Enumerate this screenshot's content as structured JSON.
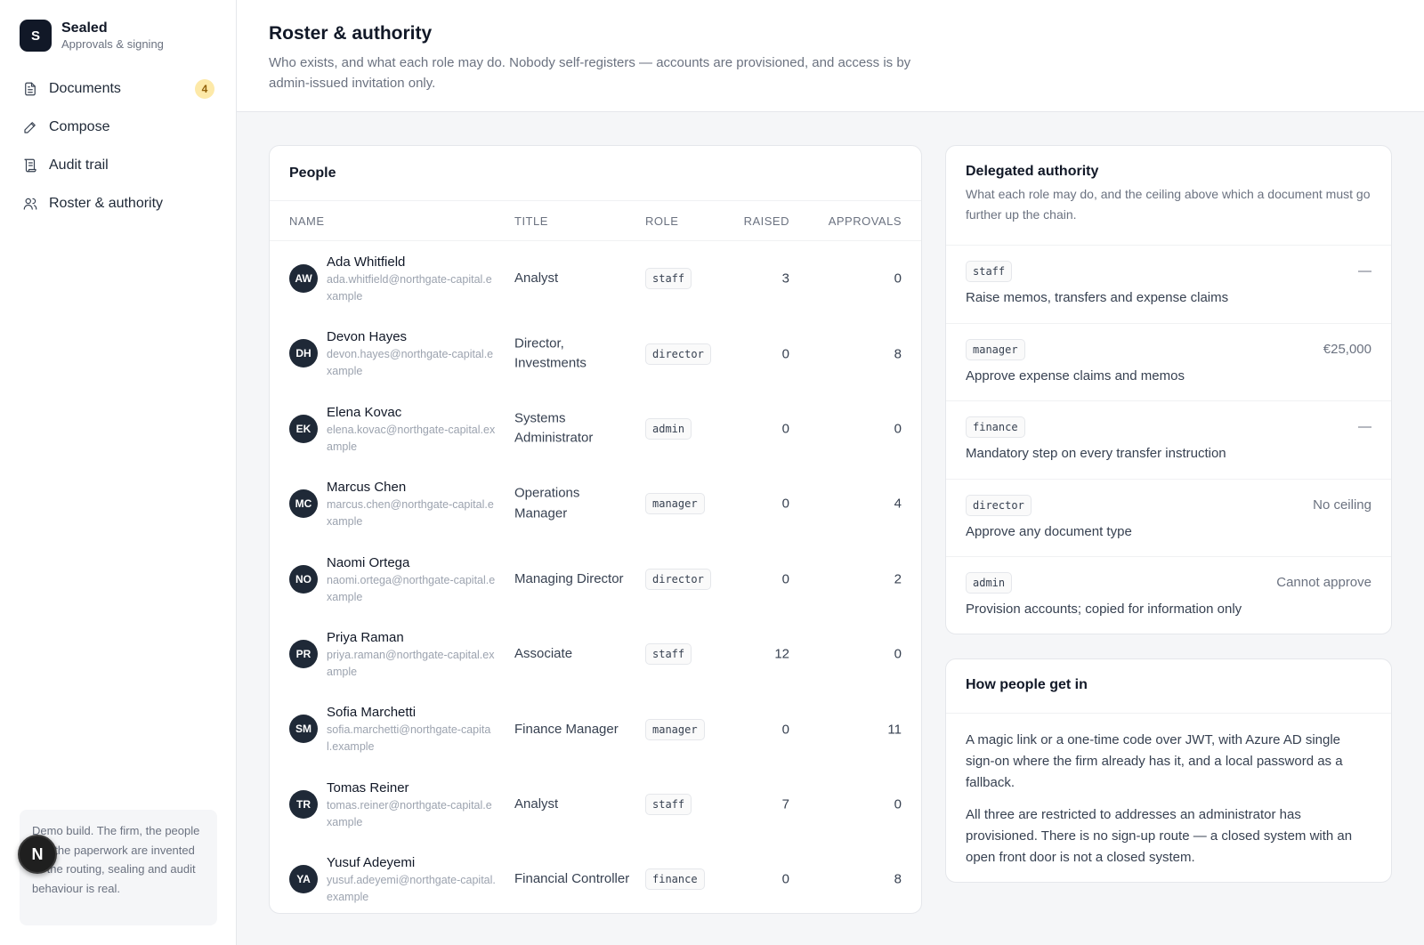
{
  "brand": {
    "mark": "S",
    "name": "Sealed",
    "subtitle": "Approvals & signing"
  },
  "nav": [
    {
      "label": "Documents",
      "icon": "document-icon",
      "badge": "4"
    },
    {
      "label": "Compose",
      "icon": "pen-icon"
    },
    {
      "label": "Audit trail",
      "icon": "scroll-icon"
    },
    {
      "label": "Roster & authority",
      "icon": "users-icon"
    }
  ],
  "demo_note": "Demo build. The firm, the people and the paperwork are invented — the routing, sealing and audit behaviour is real.",
  "fab": {
    "label": "N"
  },
  "page": {
    "title": "Roster & authority",
    "description": "Who exists, and what each role may do. Nobody self-registers — accounts are provisioned, and access is by admin-issued invitation only."
  },
  "people": {
    "title": "People",
    "columns": {
      "name": "NAME",
      "title": "TITLE",
      "role": "ROLE",
      "raised": "RAISED",
      "approvals": "APPROVALS"
    },
    "rows": [
      {
        "initials": "AW",
        "name": "Ada Whitfield",
        "email": "ada.whitfield@northgate-capital.example",
        "title": "Analyst",
        "role": "staff",
        "raised": "3",
        "approvals": "0"
      },
      {
        "initials": "DH",
        "name": "Devon Hayes",
        "email": "devon.hayes@northgate-capital.example",
        "title": "Director, Investments",
        "role": "director",
        "raised": "0",
        "approvals": "8"
      },
      {
        "initials": "EK",
        "name": "Elena Kovac",
        "email": "elena.kovac@northgate-capital.example",
        "title": "Systems Administrator",
        "role": "admin",
        "raised": "0",
        "approvals": "0"
      },
      {
        "initials": "MC",
        "name": "Marcus Chen",
        "email": "marcus.chen@northgate-capital.example",
        "title": "Operations Manager",
        "role": "manager",
        "raised": "0",
        "approvals": "4"
      },
      {
        "initials": "NO",
        "name": "Naomi Ortega",
        "email": "naomi.ortega@northgate-capital.example",
        "title": "Managing Director",
        "role": "director",
        "raised": "0",
        "approvals": "2"
      },
      {
        "initials": "PR",
        "name": "Priya Raman",
        "email": "priya.raman@northgate-capital.example",
        "title": "Associate",
        "role": "staff",
        "raised": "12",
        "approvals": "0"
      },
      {
        "initials": "SM",
        "name": "Sofia Marchetti",
        "email": "sofia.marchetti@northgate-capital.example",
        "title": "Finance Manager",
        "role": "manager",
        "raised": "0",
        "approvals": "11"
      },
      {
        "initials": "TR",
        "name": "Tomas Reiner",
        "email": "tomas.reiner@northgate-capital.example",
        "title": "Analyst",
        "role": "staff",
        "raised": "7",
        "approvals": "0"
      },
      {
        "initials": "YA",
        "name": "Yusuf Adeyemi",
        "email": "yusuf.adeyemi@northgate-capital.example",
        "title": "Financial Controller",
        "role": "finance",
        "raised": "0",
        "approvals": "8"
      }
    ]
  },
  "authority": {
    "title": "Delegated authority",
    "description": "What each role may do, and the ceiling above which a document must go further up the chain.",
    "rows": [
      {
        "role": "staff",
        "limit": "—",
        "text": "Raise memos, transfers and expense claims"
      },
      {
        "role": "manager",
        "limit": "€25,000",
        "text": "Approve expense claims and memos"
      },
      {
        "role": "finance",
        "limit": "—",
        "text": "Mandatory step on every transfer instruction"
      },
      {
        "role": "director",
        "limit": "No ceiling",
        "text": "Approve any document type"
      },
      {
        "role": "admin",
        "limit": "Cannot approve",
        "text": "Provision accounts; copied for information only"
      }
    ]
  },
  "how": {
    "title": "How people get in",
    "paragraphs": [
      "A magic link or a one-time code over JWT, with Azure AD single sign-on where the firm already has it, and a local password as a fallback.",
      "All three are restricted to addresses an administrator has provisioned. There is no sign-up route — a closed system with an open front door is not a closed system."
    ]
  }
}
